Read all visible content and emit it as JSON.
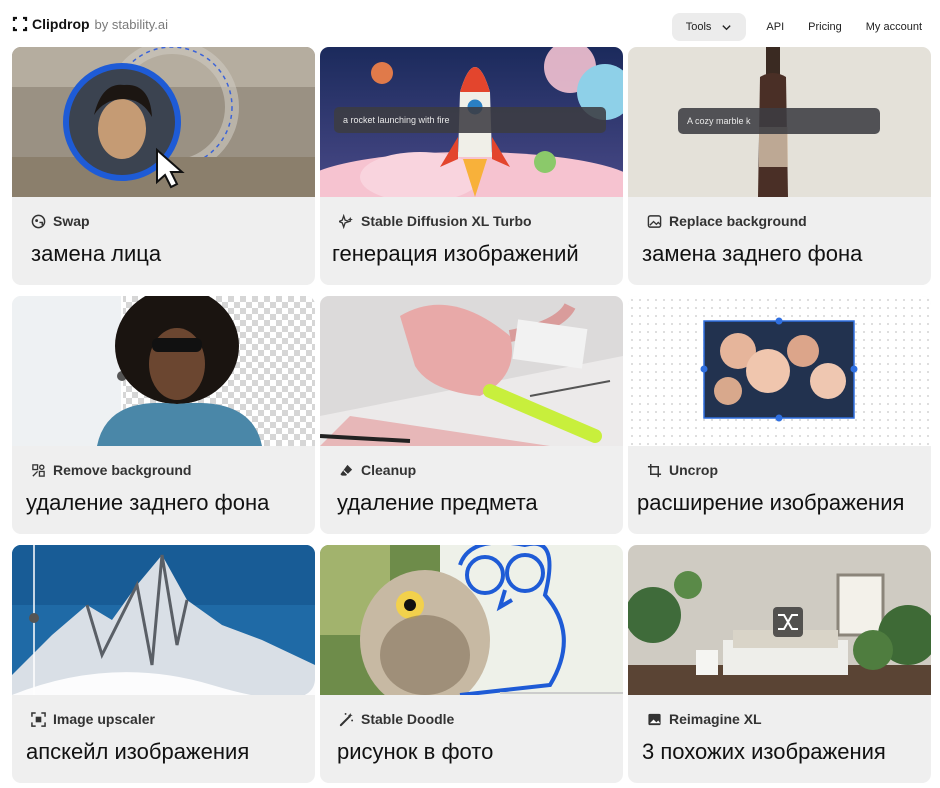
{
  "header": {
    "brand": "Clipdrop",
    "by": "by stability.ai",
    "nav": {
      "tools": "Tools",
      "api": "API",
      "pricing": "Pricing",
      "account": "My account"
    }
  },
  "cards": [
    {
      "title": "Swap",
      "desc": "замена лица",
      "icon": "face-swap-icon"
    },
    {
      "title": "Stable Diffusion XL Turbo",
      "desc": "генерация изображений",
      "icon": "sparkle-ai-icon",
      "prompt": "a rocket launching with fire"
    },
    {
      "title": "Replace background",
      "desc": "замена заднего фона",
      "icon": "replace-image-icon",
      "prompt": "A cozy marble k"
    },
    {
      "title": "Remove background",
      "desc": "удаление заднего фона",
      "icon": "remove-bg-icon"
    },
    {
      "title": "Cleanup",
      "desc": "удаление предмета",
      "icon": "eraser-icon"
    },
    {
      "title": "Uncrop",
      "desc": "расширение изображения",
      "icon": "crop-icon"
    },
    {
      "title": "Image upscaler",
      "desc": "апскейл изображения",
      "icon": "upscale-icon"
    },
    {
      "title": "Stable Doodle",
      "desc": "рисунок в фото",
      "icon": "magic-wand-icon"
    },
    {
      "title": "Reimagine XL",
      "desc": "3 похожих изображения",
      "icon": "image-icon"
    }
  ],
  "colors": {
    "card_bg": "#efefef",
    "accent_blue": "#1e5bd6",
    "nav_pill": "#ececec"
  }
}
